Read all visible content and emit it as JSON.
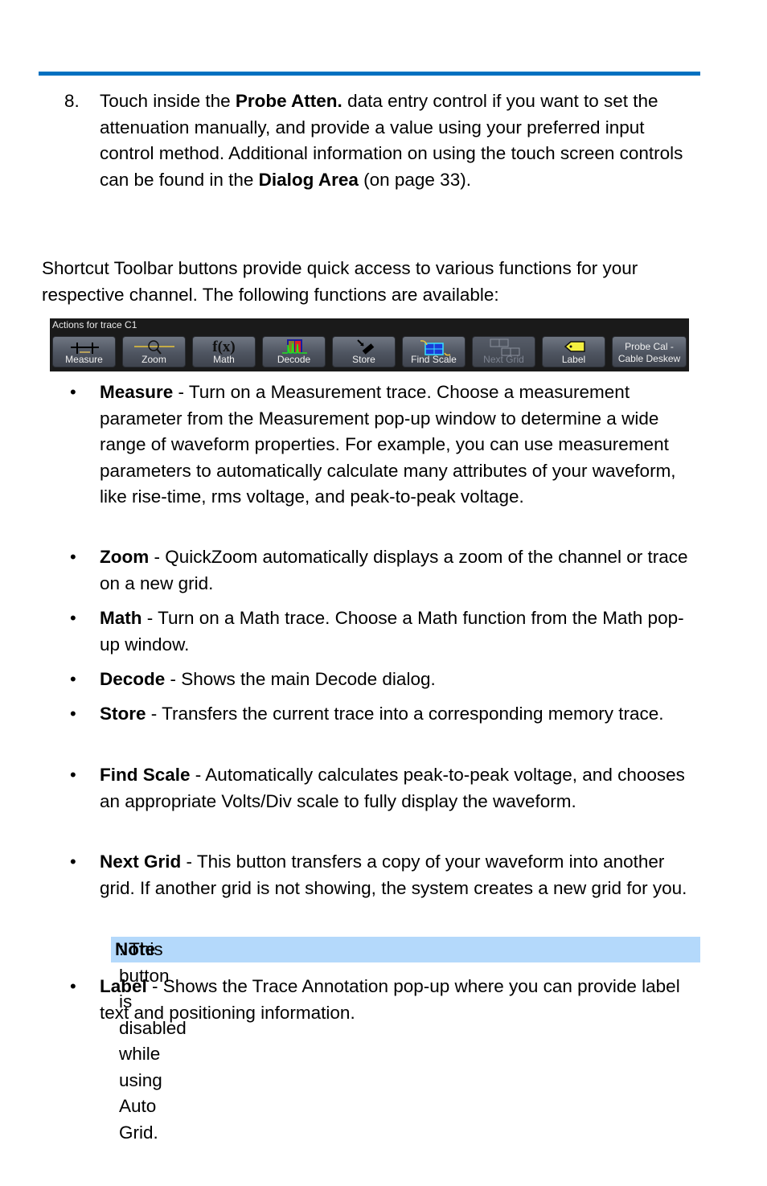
{
  "step": {
    "number": "8.",
    "pre": "Touch inside the ",
    "bold1": "Probe Atten.",
    "mid": " data entry control if you want to set the attenuation manually, and provide a value using your preferred input control method. Additional information on using the touch screen controls can be found in the ",
    "bold2": "Dialog Area",
    "post": " (on page 33)."
  },
  "intro": "Shortcut Toolbar buttons provide quick access to various functions for your respective channel. The following functions are available:",
  "toolbar": {
    "title": "Actions for trace C1",
    "buttons": [
      {
        "label": "Measure",
        "icon": "measure-icon"
      },
      {
        "label": "Zoom",
        "icon": "zoom-icon"
      },
      {
        "label": "Math",
        "icon": "fx-icon",
        "glyph": "f(x)"
      },
      {
        "label": "Decode",
        "icon": "decode-icon"
      },
      {
        "label": "Store",
        "icon": "store-icon"
      },
      {
        "label": "Find Scale",
        "icon": "find-scale-icon"
      },
      {
        "label": "Next Grid",
        "icon": "next-grid-icon",
        "disabled": true
      },
      {
        "label": "Label",
        "icon": "label-tag-icon"
      },
      {
        "label": "Probe Cal -",
        "label2": "Cable Deskew"
      }
    ]
  },
  "items": [
    {
      "term": "Measure",
      "desc": " - Turn on a Measurement trace. Choose a measurement parameter from the Measurement pop-up window to determine a wide range of waveform properties. For example, you can use measurement parameters to automatically calculate many attributes of your waveform, like rise-time, rms voltage, and peak-to-peak voltage."
    },
    {
      "term": "Zoom",
      "desc": " - QuickZoom automatically displays a zoom of the channel or trace on a new grid."
    },
    {
      "term": "Math",
      "desc": " - Turn on a Math trace. Choose a Math function from the Math pop-up window."
    },
    {
      "term": "Decode",
      "desc": " - Shows the main Decode dialog."
    },
    {
      "term": "Store",
      "desc": " - Transfers the current trace into a corresponding memory trace."
    },
    {
      "term": "Find Scale",
      "desc": " - Automatically calculates peak-to-peak voltage, and chooses an appropriate Volts/Div scale to fully display the waveform."
    },
    {
      "term": "Next Grid",
      "desc": " - This button transfers a copy of your waveform into another grid. If another grid is not showing, the system creates a new grid for you."
    },
    {
      "term": "Label",
      "desc": " - Shows the Trace Annotation pop-up where you can provide label text and positioning information."
    }
  ],
  "note": {
    "bold": "Note",
    "text": ": This button is disabled while using Auto Grid."
  }
}
